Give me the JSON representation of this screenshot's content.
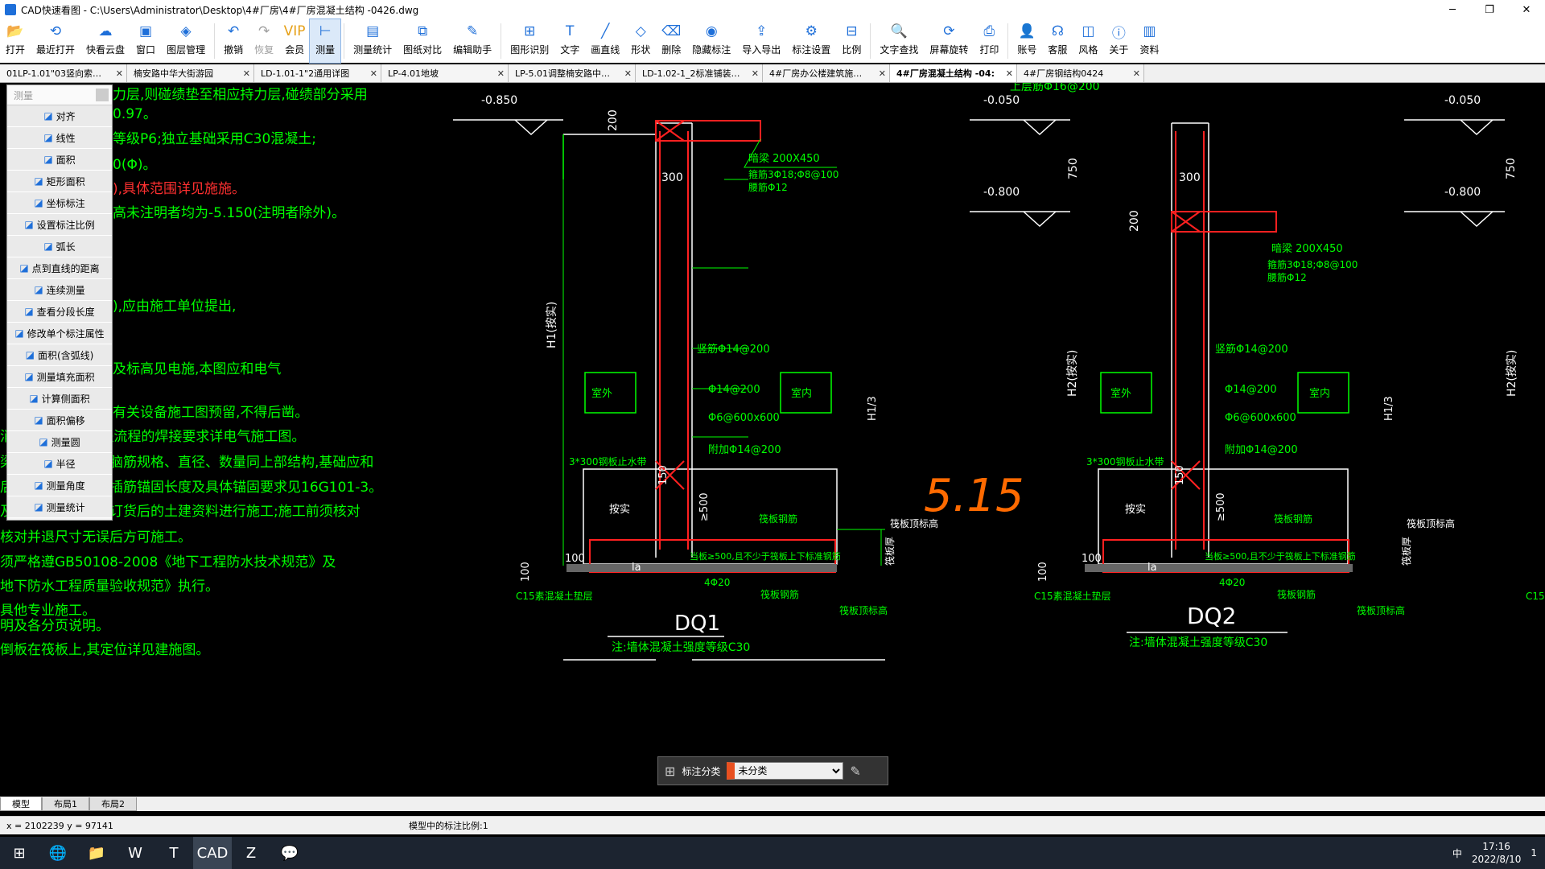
{
  "window": {
    "title": "CAD快速看图 - C:\\Users\\Administrator\\Desktop\\4#厂房\\4#厂房混凝土结构 -0426.dwg",
    "minimize": "─",
    "maximize": "❐",
    "close": "✕"
  },
  "toolbar": {
    "items": [
      {
        "label": "打开",
        "icon": "📂"
      },
      {
        "label": "最近打开",
        "icon": "⟲"
      },
      {
        "label": "快看云盘",
        "icon": "☁"
      },
      {
        "label": "窗口",
        "icon": "▣"
      },
      {
        "label": "图层管理",
        "icon": "◈"
      },
      {
        "label": "撤销",
        "icon": "↶"
      },
      {
        "label": "恢复",
        "icon": "↷"
      },
      {
        "label": "会员",
        "icon": "VIP"
      },
      {
        "label": "测量",
        "icon": "⊢"
      },
      {
        "label": "测量统计",
        "icon": "▤"
      },
      {
        "label": "图纸对比",
        "icon": "⧉"
      },
      {
        "label": "编辑助手",
        "icon": "✎"
      },
      {
        "label": "图形识别",
        "icon": "⊞"
      },
      {
        "label": "文字",
        "icon": "T"
      },
      {
        "label": "画直线",
        "icon": "╱"
      },
      {
        "label": "形状",
        "icon": "◇"
      },
      {
        "label": "删除",
        "icon": "⌫"
      },
      {
        "label": "隐藏标注",
        "icon": "◉"
      },
      {
        "label": "导入导出",
        "icon": "⇪"
      },
      {
        "label": "标注设置",
        "icon": "⚙"
      },
      {
        "label": "比例",
        "icon": "⊟"
      },
      {
        "label": "文字查找",
        "icon": "🔍"
      },
      {
        "label": "屏幕旋转",
        "icon": "⟳"
      },
      {
        "label": "打印",
        "icon": "⎙"
      },
      {
        "label": "账号",
        "icon": "👤"
      },
      {
        "label": "客服",
        "icon": "☊"
      },
      {
        "label": "风格",
        "icon": "◫"
      },
      {
        "label": "关于",
        "icon": "ⓘ"
      },
      {
        "label": "资料",
        "icon": "▥"
      }
    ]
  },
  "tabs": [
    {
      "label": "01LP-1.01\"03竖向索…",
      "width": 158
    },
    {
      "label": "楠安路中华大街游园",
      "width": 158
    },
    {
      "label": "LD-1.01-1\"2通用详图",
      "width": 158
    },
    {
      "label": "LP-4.01地坡",
      "width": 158
    },
    {
      "label": "LP-5.01调整楠安路中…",
      "width": 158
    },
    {
      "label": "LD-1.02-1_2标准铺装…",
      "width": 158
    },
    {
      "label": "4#厂房办公楼建筑施…",
      "width": 158
    },
    {
      "label": "4#厂房混凝土结构 -04:",
      "width": 158
    },
    {
      "label": "4#厂房钢结构0424",
      "width": 158
    }
  ],
  "tab_close": "✕",
  "measure_panel": {
    "title": "测量",
    "items": [
      "对齐",
      "线性",
      "面积",
      "矩形面积",
      "坐标标注",
      "设置标注比例",
      "弧长",
      "点到直线的距离",
      "连续测量",
      "查看分段长度",
      "修改单个标注属性",
      "面积(含弧线)",
      "测量填充面积",
      "计算侧面积",
      "面积偏移",
      "测量圆",
      "半径",
      "测量角度",
      "测量统计"
    ]
  },
  "drawing": {
    "notes": [
      {
        "text": "力层,则碰绩垫至相应持力层,碰绩部分采用",
        "color": "#00ff00"
      },
      {
        "text": "0.97。",
        "color": "#00ff00"
      },
      {
        "text": "等级P6;独立基础采用C30混凝土;",
        "color": "#00ff00"
      },
      {
        "text": "0(Φ)。",
        "color": "#00ff00"
      },
      {
        "text": "),具体范围详见施施。",
        "color": "#ff3030"
      },
      {
        "text": "高未注明者均为-5.150(注明者除外)。",
        "color": "#00ff00"
      },
      {
        "text": "),应由施工单位提出,",
        "color": "#00ff00"
      },
      {
        "text": "及标高见电施,本图应和电气",
        "color": "#00ff00"
      },
      {
        "text": "有关设备施工图预留,不得后凿。",
        "color": "#00ff00"
      },
      {
        "text": "消防工程,电气工程流程的焊接要求详电气施工图。",
        "color": "#00ff00"
      },
      {
        "text": "梁柱、构造柱插筋脑筋规格、直径、数量同上部结构,基础应和",
        "color": "#00ff00"
      },
      {
        "text": "后方可施工。墙柱插筋锚固长度及具体锚固要求见16G101-3。",
        "color": "#00ff00"
      },
      {
        "text": "及支架应根据电梯订货后的土建资料进行施工;施工前须核对",
        "color": "#00ff00"
      },
      {
        "text": "核对并退尺寸无误后方可施工。",
        "color": "#00ff00"
      },
      {
        "text": "须严格遵GB50108-2008《地下工程防水技术规范》及",
        "color": "#00ff00"
      },
      {
        "text": "地下防水工程质量验收规范》执行。",
        "color": "#00ff00"
      },
      {
        "text": "具他专业施工。",
        "color": "#00ff00"
      },
      {
        "text": "明及各分页说明。",
        "color": "#00ff00"
      },
      {
        "text": "倒板在筏板上,其定位详见建施图。",
        "color": "#00ff00"
      }
    ],
    "top_note": "上层筋Φ16@200",
    "elev_labels": [
      "-0.850",
      "-0.050",
      "-0.800",
      "-0.050",
      "-0.800",
      "-0.050"
    ],
    "dims": [
      "200",
      "300",
      "750",
      "300",
      "200",
      "750",
      "100",
      "100",
      "100",
      "100",
      "≥500",
      "≥500",
      "150",
      "150"
    ],
    "beam_label": "暗梁 200X450",
    "beam_reinf": "箍筋3Φ18;Φ8@100",
    "beam_waist": "腰筋Φ12",
    "vert_reinf": "竖筋Φ14@200",
    "horiz1": "Φ14@200",
    "horiz2": "Φ6@600x600",
    "add_reinf": "附加Φ14@200",
    "waterstop": "3*300钢板止水带",
    "backfill": "按实",
    "outdoor": "室外",
    "indoor": "室内",
    "h1": "H1(按实)",
    "h2": "H2(按实)",
    "h13": "H1/3",
    "raft_reinf": "筏板钢筋",
    "raft_top": "筏板顶标高",
    "raft_thick": "筏板厚",
    "c15": "C15素混凝土垫层",
    "la": "la",
    "raft_note": "当板≥500,且不少于筏板上下标准钢筋",
    "dq1": "DQ1",
    "dq2": "DQ2",
    "dq_note": "注:墙体混凝土强度等级C30",
    "handwriting": "5.15",
    "small420": "4Φ20"
  },
  "annotation_bar": {
    "label": "标注分类",
    "selected": "未分类",
    "swatch_color": "#e85020"
  },
  "bottom_tabs": [
    "模型",
    "布局1",
    "布局2"
  ],
  "status": {
    "coords": "x = 2102239  y = 97141",
    "scale": "模型中的标注比例:1"
  },
  "taskbar": {
    "apps": [
      "⊞",
      "🌐",
      "📁",
      "W",
      "T",
      "CAD",
      "Z",
      "💬"
    ],
    "ime": "中",
    "time": "17:16",
    "date": "2022/8/10",
    "notif": "1"
  },
  "colors": {
    "green": "#00ff00",
    "red": "#ff2020",
    "white": "#ffffff",
    "orange": "#ff6a00",
    "accent": "#1e6fd9"
  }
}
